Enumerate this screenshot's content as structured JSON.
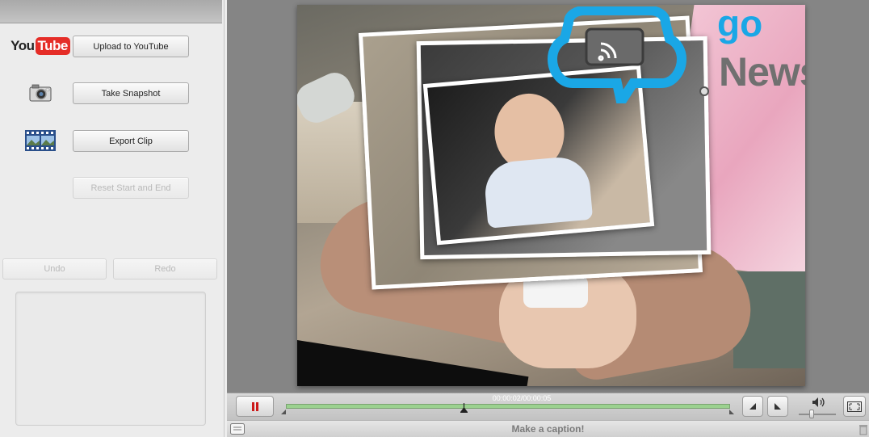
{
  "sidebar": {
    "youtube_logo": {
      "you": "You",
      "tube": "Tube"
    },
    "upload_label": "Upload to YouTube",
    "snapshot_label": "Take Snapshot",
    "export_label": "Export Clip",
    "reset_label": "Reset Start and End",
    "undo_label": "Undo",
    "redo_label": "Redo"
  },
  "player": {
    "timecode": "00:00:02/00:00:05",
    "progress": 0.4,
    "volume": 0.35,
    "caption_placeholder": "Make a caption!"
  },
  "watermark": {
    "go": "go",
    "news": "News"
  },
  "icons": [
    "youtube-logo",
    "camera-icon",
    "film-strip-icon",
    "pause-icon",
    "previous-frame-icon",
    "next-frame-icon",
    "volume-icon",
    "fullscreen-icon",
    "caption-icon"
  ],
  "colors": {
    "pause": "#cc1a1a",
    "track": "#9bd18f",
    "watermark_blue": "#1aa7e6",
    "watermark_gray": "#707070"
  }
}
